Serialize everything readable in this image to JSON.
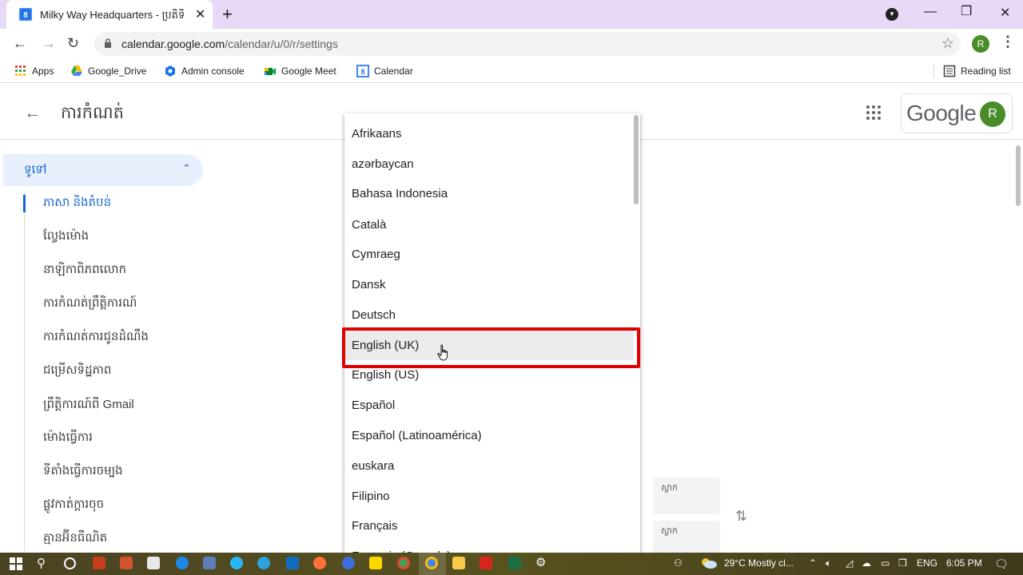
{
  "browser": {
    "tab_title": "Milky Way Headquarters - ប្រតិទិ",
    "tab_favicon": "calendar-icon",
    "url_host": "calendar.google.com",
    "url_path": "/calendar/u/0/r/settings",
    "profile_initial": "R",
    "bookmarks": [
      {
        "label": "Apps",
        "icon": "apps-grid-icon"
      },
      {
        "label": "Google_Drive",
        "icon": "google-drive-icon"
      },
      {
        "label": "Admin console",
        "icon": "admin-console-icon"
      },
      {
        "label": "Google Meet",
        "icon": "google-meet-icon"
      },
      {
        "label": "Calendar",
        "icon": "calendar-icon"
      }
    ],
    "reading_list": "Reading list"
  },
  "header": {
    "title": "ការកំណត់",
    "google_logo": "Google",
    "account_initial": "R"
  },
  "sidebar": {
    "section": "ទូទៅ",
    "items": [
      {
        "label": "ភាសា និងតំបន់",
        "active": true
      },
      {
        "label": "ល្វែងម៉ោង"
      },
      {
        "label": "នាឡិកាពិភពលោក"
      },
      {
        "label": "ការកំណត់ព្រឹត្តិការណ៍"
      },
      {
        "label": "ការកំណត់ការជូនដំណឹង"
      },
      {
        "label": "ជម្រើសទិដ្ឋភាព"
      },
      {
        "label": "ព្រឹត្តិការណ៍ពី Gmail"
      },
      {
        "label": "ម៉ោងធ្វើការ"
      },
      {
        "label": "ទីតាំងធ្វើការចម្បង"
      },
      {
        "label": "ផ្លូវកាត់ក្ដារចុច"
      },
      {
        "label": "គ្មានអ៊ីនធឺណិត"
      }
    ]
  },
  "timezone_boxes": [
    "ស្លាក",
    "ស្លាក"
  ],
  "language_dropdown": {
    "hovered": "English (UK)",
    "options": [
      "Afrikaans",
      "azərbaycan",
      "Bahasa Indonesia",
      "Català",
      "Cymraeg",
      "Dansk",
      "Deutsch",
      "English (UK)",
      "English (US)",
      "Español",
      "Español (Latinoamérica)",
      "euskara",
      "Filipino",
      "Français",
      "Français (Canada)"
    ]
  },
  "taskbar": {
    "weather": "29°C  Mostly cl...",
    "language": "ENG",
    "time": "6:05 PM"
  }
}
